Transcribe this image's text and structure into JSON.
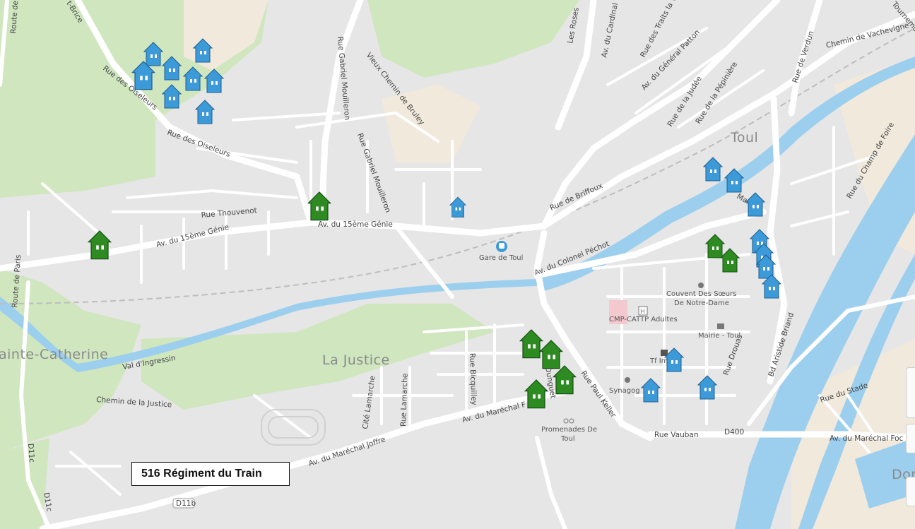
{
  "map": {
    "town_labels": {
      "toul": "Toul",
      "la_justice": "La Justice",
      "sainte_catherine": "ainte-Catherine",
      "dom": "Dom"
    },
    "road_labels": {
      "rue_des_oiseleurs_1": "Rue des Oiseleurs",
      "rue_des_oiseleurs_2": "Rue des Oiseleurs",
      "rue_thouvenot": "Rue Thouvenot",
      "av_15e_genie_1": "Av. du 15ème Génie",
      "av_15e_genie_2": "Av. du 15ème Génie",
      "rue_gabriel_mouilleron_1": "Rue Gabriel Mouilleron",
      "rue_gabriel_mouilleron_2": "Rue Gabriel Mouilleron",
      "vieux_chemin_bruley": "Vieux Chemin de Bruley",
      "rue_de_briffoux": "Rue de Briffoux",
      "av_colonel_pechot": "Av. du Colonel Péchot",
      "les_roses": "Les Roses",
      "av_cardinal": "Av. du Cardinal",
      "rue_traits": "Rue des Traits la Vi",
      "av_general_patton": "Av. du Général Patton",
      "rue_de_la_judee": "Rue de la Judée",
      "rue_de_la_pepiniere": "Rue de la Pépinière",
      "rue_de_verdun": "Rue de Verdun",
      "chemin_vachevigne": "Chemin de Vachevigne",
      "tournemo": "Tournemo",
      "rue_champ_de_foire": "Rue du Champ de Foire",
      "bd_aristide_briand": "Bd Aristide Briand",
      "rue_drouas": "Rue Drouas",
      "rue_paul_keller": "Rue Paul Keller",
      "rue_vauban": "Rue Vauban",
      "d400": "D400",
      "av_marechal_foch": "Av. du Maréchal Foc",
      "rue_du_stade": "Rue du Stade",
      "av_marechal_joffre": "Av. du Maréchal Joffre",
      "av_marechal_f": "Av. du Maréchal F",
      "rue_bicquilley": "Rue Bicquilley",
      "cite_lamarche": "Cité Lamarche",
      "rue_lamarche": "Rue Lamarche",
      "chemin_justice": "Chemin de la Justice",
      "val_dingressin": "Val d'Ingressin",
      "route_de_paris": "Route de Paris",
      "route_de": "Route de",
      "d11c_1": "D11c",
      "d11c_2": "D11c",
      "d11b": "D11b",
      "rue_st_brice": "t-Brice",
      "rue_mai": "Mai",
      "rue_dunguet": "Dunguet"
    },
    "poi_labels": {
      "gare_de_toul": "Gare de Toul",
      "couvent_1": "Couvent Des Sœurs",
      "couvent_2": "De Notre-Dame",
      "cmp_cattp": "CMP-CATTP Adultes",
      "mairie_toul": "Mairie - Toul",
      "synagogue": "Synagog",
      "tf_im": "Tf Im",
      "promenades_1": "Promenades De",
      "promenades_2": "Toul"
    },
    "colors": {
      "house_blue": "#3d9ad8",
      "house_green": "#2e8b22",
      "water": "#9ccfee",
      "park": "#c9e3b7"
    },
    "legend_box": {
      "label": "516 Régiment du Train"
    }
  }
}
